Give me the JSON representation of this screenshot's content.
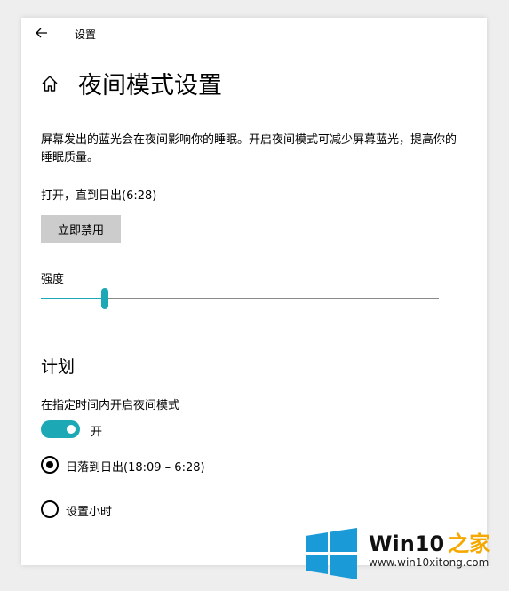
{
  "titlebar": {
    "title": "设置"
  },
  "page": {
    "title": "夜间模式设置",
    "description": "屏幕发出的蓝光会在夜间影响你的睡眠。开启夜间模式可减少屏幕蓝光，提高你的睡眠质量。",
    "status": "打开，直到日出(6:28)",
    "disable_button": "立即禁用"
  },
  "strength": {
    "label": "强度",
    "value": 0.16
  },
  "schedule": {
    "title": "计划",
    "toggle_label": "在指定时间内开启夜间模式",
    "toggle_on": true,
    "toggle_state": "开",
    "options": [
      {
        "label": "日落到日出(18:09 – 6:28)",
        "checked": true
      },
      {
        "label": "设置小时",
        "checked": false
      }
    ]
  },
  "colors": {
    "accent": "#1ca8b5",
    "button_bg": "#cccccc"
  },
  "icons": {
    "back": "arrow-left-icon",
    "home": "home-icon"
  },
  "watermark": {
    "brand": "Win10",
    "brand_accent": "之家",
    "url": "www.win10xitong.com"
  }
}
